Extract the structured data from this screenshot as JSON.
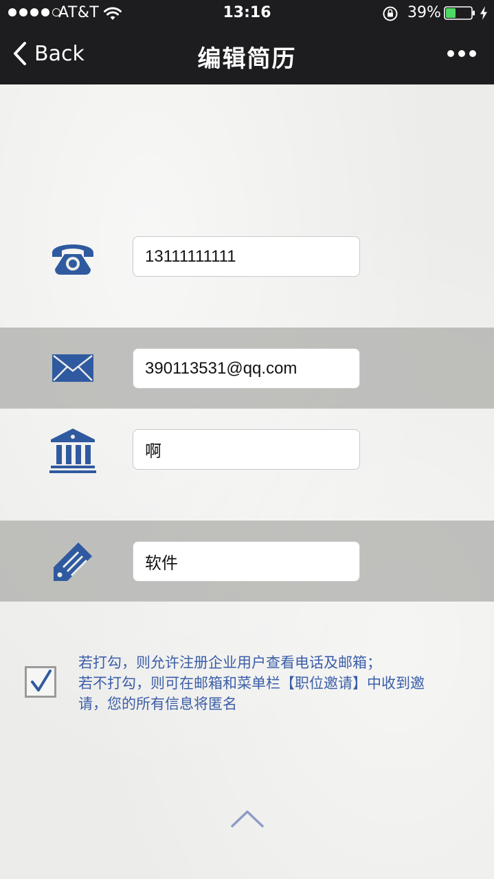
{
  "status_bar": {
    "carrier": "AT&T",
    "time": "13:16",
    "battery_percent": "39%",
    "battery_level": 0.39,
    "signal_bars_filled": 4,
    "signal_bars_total": 5
  },
  "nav": {
    "back_label": "Back",
    "title": "编辑简历"
  },
  "fields": {
    "phone": {
      "value": "13111111111",
      "icon": "telephone-icon"
    },
    "email": {
      "value": "390113531@qq.com",
      "icon": "envelope-icon"
    },
    "school": {
      "value": "啊",
      "icon": "institution-icon"
    },
    "major": {
      "value": "软件",
      "icon": "tag-pencil-icon"
    }
  },
  "consent": {
    "checked": true,
    "line1": "若打勾，则允许注册企业用户查看电话及邮箱；",
    "line2": "若不打勾，则可在邮箱和菜单栏【职位邀请】中收到邀",
    "line3": "请，您的所有信息将匿名"
  },
  "colors": {
    "accent": "#2f5a9f",
    "text_blue": "#3b5ea8",
    "header_bg": "#1d1d1f",
    "battery_green": "#4cd964"
  }
}
